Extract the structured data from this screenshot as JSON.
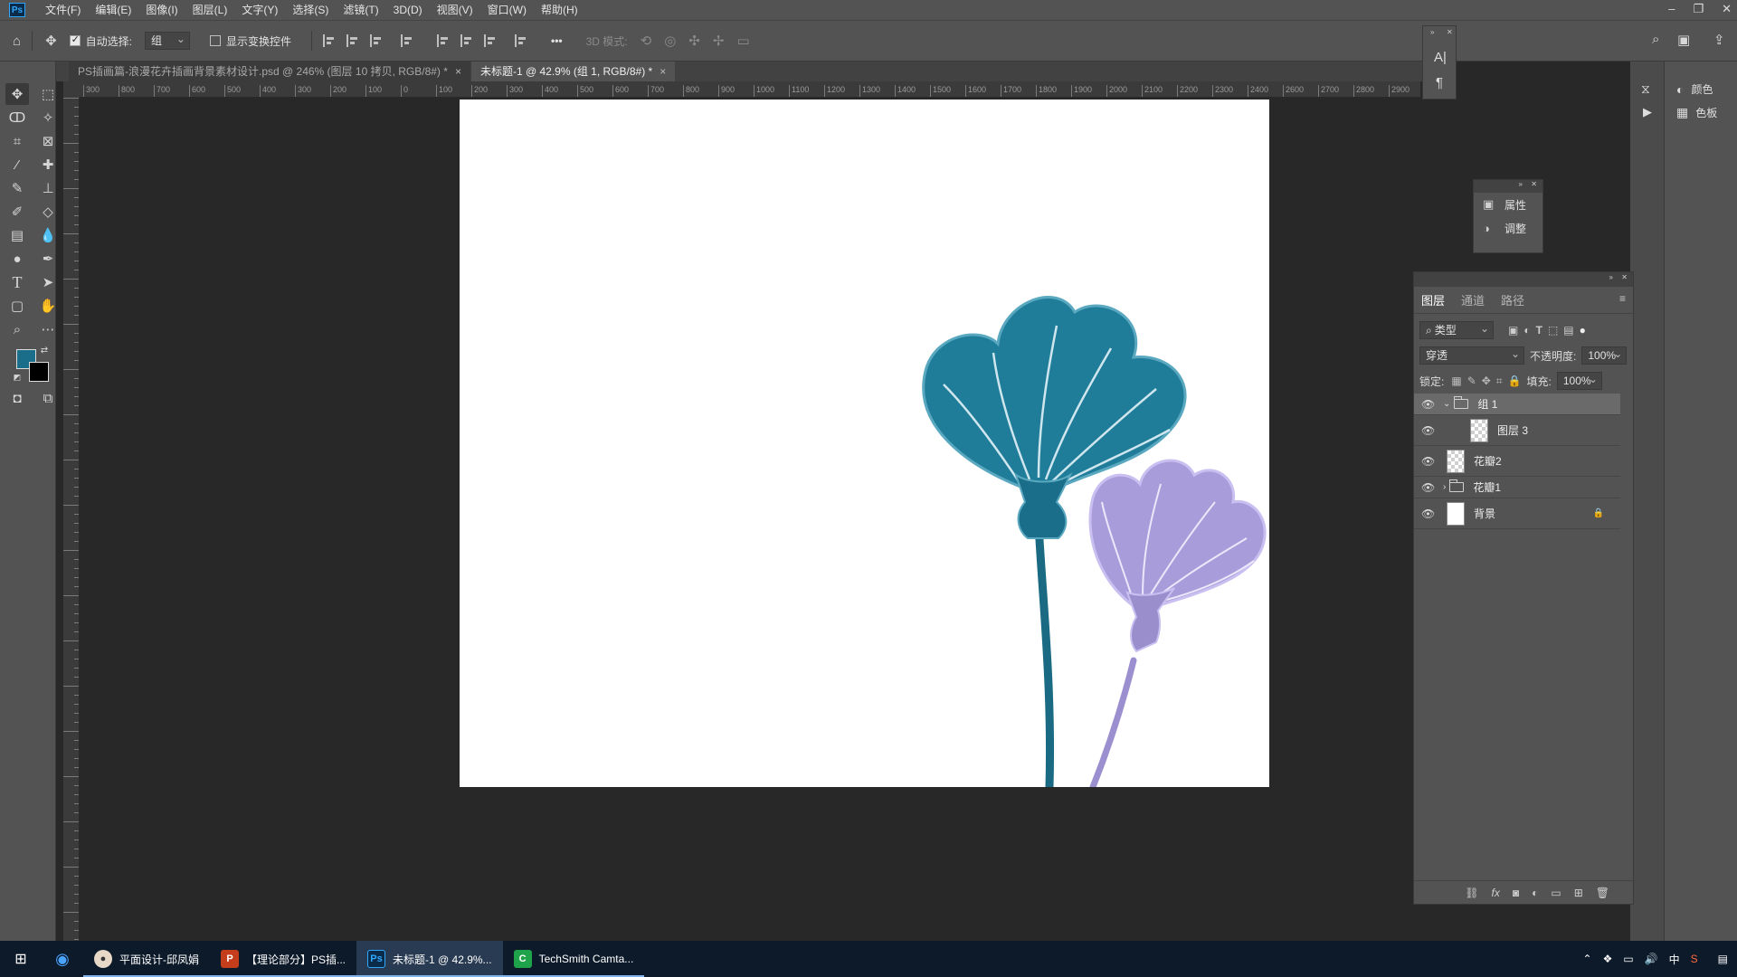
{
  "app": {
    "logo_text": "Ps",
    "menus": [
      "文件(F)",
      "编辑(E)",
      "图像(I)",
      "图层(L)",
      "文字(Y)",
      "选择(S)",
      "滤镜(T)",
      "3D(D)",
      "视图(V)",
      "窗口(W)",
      "帮助(H)"
    ],
    "window_controls": [
      "–",
      "❐",
      "✕"
    ]
  },
  "options_bar": {
    "auto_select_label": "自动选择:",
    "auto_select_checked": true,
    "auto_select_value": "组",
    "show_transform_label": "显示变换控件",
    "show_transform_checked": false,
    "more_label": "•••",
    "mode_3d_label": "3D 模式:"
  },
  "tabs": [
    {
      "label": "PS插画篇-浪漫花卉插画背景素材设计.psd @ 246% (图层 10 拷贝, RGB/8#) *",
      "active": false,
      "close": "×"
    },
    {
      "label": "未标题-1 @ 42.9% (组 1, RGB/8#) *",
      "active": true,
      "close": "×"
    }
  ],
  "ruler": {
    "h_ticks": [
      "300",
      "800",
      "700",
      "600",
      "500",
      "400",
      "300",
      "200",
      "100",
      "0",
      "100",
      "200",
      "300",
      "400",
      "500",
      "600",
      "700",
      "800",
      "900",
      "1000",
      "1100",
      "1200",
      "1300",
      "1400",
      "1500",
      "1600",
      "1700",
      "1800",
      "1900",
      "2000",
      "2100",
      "2200",
      "2300",
      "2400",
      "2600",
      "2700",
      "2800",
      "2900"
    ]
  },
  "colors": {
    "foreground": "#1a6e8a",
    "background": "#000000",
    "flower_blue": "#1f7d99",
    "flower_purple": "#9a8fcc",
    "selected_layer": "#6a6a6a"
  },
  "properties_panel": {
    "items": [
      {
        "icon": "properties-icon",
        "label": "属性"
      },
      {
        "icon": "adjustments-icon",
        "label": "调整"
      }
    ]
  },
  "right_dock": {
    "items": [
      {
        "icon": "color-icon",
        "label": "颜色"
      },
      {
        "icon": "swatches-icon",
        "label": "色板"
      }
    ]
  },
  "layers_panel": {
    "tabs": [
      "图层",
      "通道",
      "路径"
    ],
    "filter_label": "类型",
    "blend_mode": "穿透",
    "opacity_label": "不透明度:",
    "opacity_value": "100%",
    "lock_label": "锁定:",
    "fill_label": "填充:",
    "fill_value": "100%",
    "layers": [
      {
        "name": "组 1",
        "type": "group",
        "expanded": true,
        "selected": true
      },
      {
        "name": "图层 3",
        "type": "layer",
        "thumb": "checker",
        "indent": true
      },
      {
        "name": "花瓣2",
        "type": "layer",
        "thumb": "checker"
      },
      {
        "name": "花瓣1",
        "type": "group",
        "expanded": false
      },
      {
        "name": "背景",
        "type": "layer",
        "thumb": "white",
        "locked": true
      }
    ]
  },
  "taskbar": {
    "items": [
      {
        "label": "平面设计-邱凤娟",
        "icon": "chrome-user-icon"
      },
      {
        "label": "【理论部分】PS插...",
        "icon": "powerpoint-icon"
      },
      {
        "label": "未标题-1 @ 42.9%...",
        "icon": "photoshop-icon",
        "active": true
      },
      {
        "label": "TechSmith Camta...",
        "icon": "camtasia-icon"
      }
    ],
    "tray": {
      "ime": "中"
    }
  }
}
